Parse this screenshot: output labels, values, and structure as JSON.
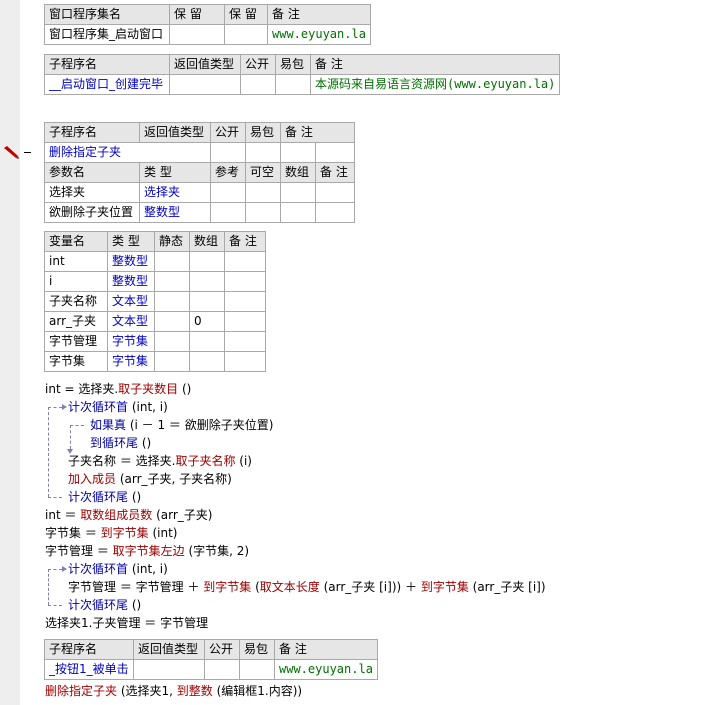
{
  "table_assembly": {
    "headers": [
      "窗口程序集名",
      "保 留",
      "保 留",
      "备 注"
    ],
    "row": [
      "窗口程序集_启动窗口",
      "",
      "",
      "www.eyuyan.la"
    ]
  },
  "table_sub1": {
    "headers": [
      "子程序名",
      "返回值类型",
      "公开",
      "易包",
      "备 注"
    ],
    "row": [
      "__启动窗口_创建完毕",
      "",
      "",
      "",
      "本源码来自易语言资源网(www.eyuyan.la)"
    ]
  },
  "table_sub2": {
    "headers": [
      "子程序名",
      "返回值类型",
      "公开",
      "易包",
      "备 注"
    ],
    "row": [
      "删除指定子夹",
      "",
      "",
      "",
      ""
    ],
    "param_headers": [
      "参数名",
      "类 型",
      "参考",
      "可空",
      "数组",
      "备 注"
    ],
    "params": [
      [
        "选择夹",
        "选择夹",
        "",
        "",
        "",
        ""
      ],
      [
        "欲删除子夹位置",
        "整数型",
        "",
        "",
        "",
        ""
      ]
    ]
  },
  "table_vars": {
    "headers": [
      "变量名",
      "类 型",
      "静态",
      "数组",
      "备 注"
    ],
    "rows": [
      [
        "int",
        "整数型",
        "",
        "",
        ""
      ],
      [
        "i",
        "整数型",
        "",
        "",
        ""
      ],
      [
        "子夹名称",
        "文本型",
        "",
        "",
        ""
      ],
      [
        "arr_子夹",
        "文本型",
        "",
        "0",
        ""
      ],
      [
        "字节管理",
        "字节集",
        "",
        "",
        ""
      ],
      [
        "字节集",
        "字节集",
        "",
        "",
        ""
      ]
    ]
  },
  "code": {
    "l1_a": "int = 选择夹.",
    "l1_b": "取子夹数目",
    "l1_c": " ()",
    "l2_a": "计次循环首",
    "l2_b": " (int, i)",
    "l3_a": "如果真",
    "l3_b": " (i － 1 ＝ 欲删除子夹位置)",
    "l4_a": "到循环尾",
    "l4_b": " ()",
    "l5_a": "子夹名称 ＝ 选择夹.",
    "l5_b": "取子夹名称",
    "l5_c": " (i)",
    "l6_a": "加入成员",
    "l6_b": " (arr_子夹, 子夹名称)",
    "l7_a": "计次循环尾",
    "l7_b": " ()",
    "l8_a": "int ＝ ",
    "l8_b": "取数组成员数",
    "l8_c": " (arr_子夹)",
    "l9_a": "字节集 ＝ ",
    "l9_b": "到字节集",
    "l9_c": " (int)",
    "l10_a": "字节管理 ＝ ",
    "l10_b": "取字节集左边",
    "l10_c": " (字节集, 2)",
    "l11_a": "计次循环首",
    "l11_b": " (int, i)",
    "l12_a": "字节管理 ＝ 字节管理 ＋ ",
    "l12_b": "到字节集",
    "l12_c": " (",
    "l12_d": "取文本长度",
    "l12_e": " (arr_子夹 [i])) ＋ ",
    "l12_f": "到字节集",
    "l12_g": " (arr_子夹 [i])",
    "l13_a": "计次循环尾",
    "l13_b": " ()",
    "l14": "选择夹1.子夹管理 ＝ 字节管理"
  },
  "table_sub3": {
    "headers": [
      "子程序名",
      "返回值类型",
      "公开",
      "易包",
      "备 注"
    ],
    "row": [
      "_按钮1_被单击",
      "",
      "",
      "",
      "www.eyuyan.la"
    ]
  },
  "code2": {
    "a": "删除指定子夹",
    "b": " (选择夹1, ",
    "c": "到整数",
    "d": " (编辑框1.内容))"
  }
}
